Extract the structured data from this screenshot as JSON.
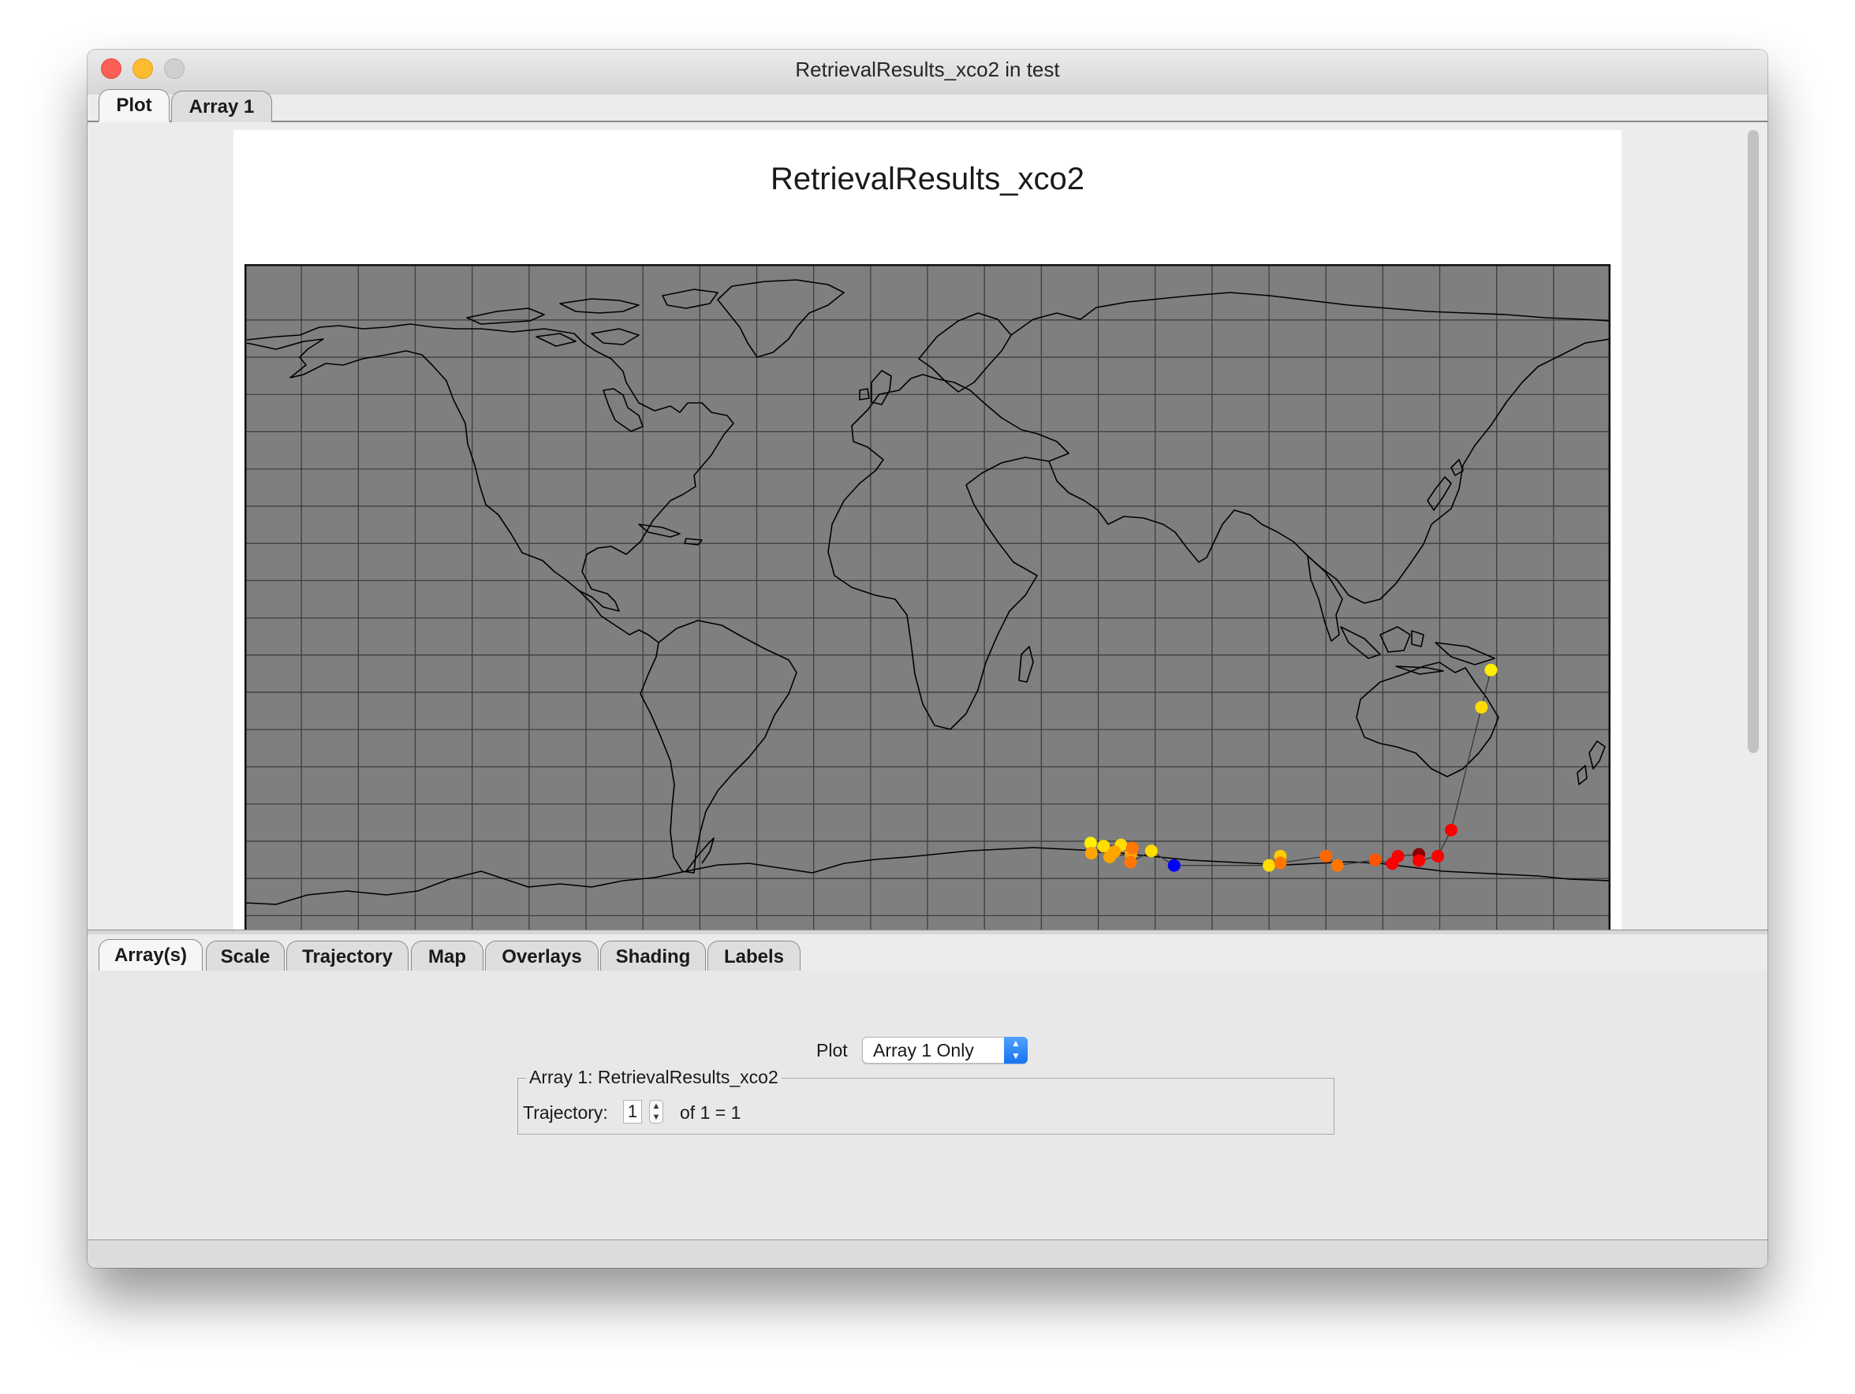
{
  "window": {
    "title": "RetrievalResults_xco2 in test"
  },
  "top_tabs": [
    {
      "label": "Plot",
      "active": true
    },
    {
      "label": "Array 1",
      "active": false
    }
  ],
  "plot": {
    "title": "RetrievalResults_xco2",
    "map": {
      "type": "world-map",
      "projection": "equirectangular",
      "background": "#7f7f7f",
      "grid": true,
      "coastline_color": "#000000"
    },
    "trajectory_points": [
      {
        "lon": 43.0,
        "lat": -65.5,
        "color": "#ffee00"
      },
      {
        "lon": 46.4,
        "lat": -66.3,
        "color": "#ffdd00"
      },
      {
        "lon": 51.0,
        "lat": -66.0,
        "color": "#ffdd00"
      },
      {
        "lon": 43.2,
        "lat": -68.2,
        "color": "#ffa500"
      },
      {
        "lon": 49.3,
        "lat": -67.8,
        "color": "#ffa500"
      },
      {
        "lon": 48.0,
        "lat": -69.2,
        "color": "#ffa500"
      },
      {
        "lon": 53.6,
        "lat": -68.4,
        "color": "#ffa500"
      },
      {
        "lon": 54.0,
        "lat": -66.8,
        "color": "#ff7700"
      },
      {
        "lon": 53.5,
        "lat": -70.6,
        "color": "#ff7700"
      },
      {
        "lon": 59.0,
        "lat": -67.6,
        "color": "#ffdd00"
      },
      {
        "lon": 65.0,
        "lat": -71.5,
        "color": "#0000ff"
      },
      {
        "lon": 90.0,
        "lat": -71.5,
        "color": "#ffdd00"
      },
      {
        "lon": 93.0,
        "lat": -69.0,
        "color": "#ffcc00"
      },
      {
        "lon": 93.0,
        "lat": -70.8,
        "color": "#ff7700"
      },
      {
        "lon": 105.0,
        "lat": -69.0,
        "color": "#ff6600"
      },
      {
        "lon": 108.0,
        "lat": -71.5,
        "color": "#ff7700"
      },
      {
        "lon": 118.0,
        "lat": -70.0,
        "color": "#ff5500"
      },
      {
        "lon": 122.5,
        "lat": -71.0,
        "color": "#ff0000"
      },
      {
        "lon": 124.0,
        "lat": -69.0,
        "color": "#ff0000"
      },
      {
        "lon": 129.5,
        "lat": -68.5,
        "color": "#880000"
      },
      {
        "lon": 129.5,
        "lat": -70.2,
        "color": "#ff0000"
      },
      {
        "lon": 134.5,
        "lat": -69.0,
        "color": "#ff0000"
      },
      {
        "lon": 138.0,
        "lat": -62.0,
        "color": "#ff0000"
      },
      {
        "lon": 146.0,
        "lat": -29.0,
        "color": "#ffdd00"
      },
      {
        "lon": 148.5,
        "lat": -19.0,
        "color": "#ffee00"
      }
    ]
  },
  "bottom_tabs": [
    {
      "label": "Array(s)",
      "active": true
    },
    {
      "label": "Scale",
      "active": false
    },
    {
      "label": "Trajectory",
      "active": false
    },
    {
      "label": "Map",
      "active": false
    },
    {
      "label": "Overlays",
      "active": false
    },
    {
      "label": "Shading",
      "active": false
    },
    {
      "label": "Labels",
      "active": false
    }
  ],
  "controls": {
    "plot_label": "Plot",
    "plot_select_value": "Array 1 Only",
    "array_group_title": "Array 1: RetrievalResults_xco2",
    "trajectory_label": "Trajectory:",
    "trajectory_value": "1",
    "trajectory_of": "of 1 = 1"
  }
}
